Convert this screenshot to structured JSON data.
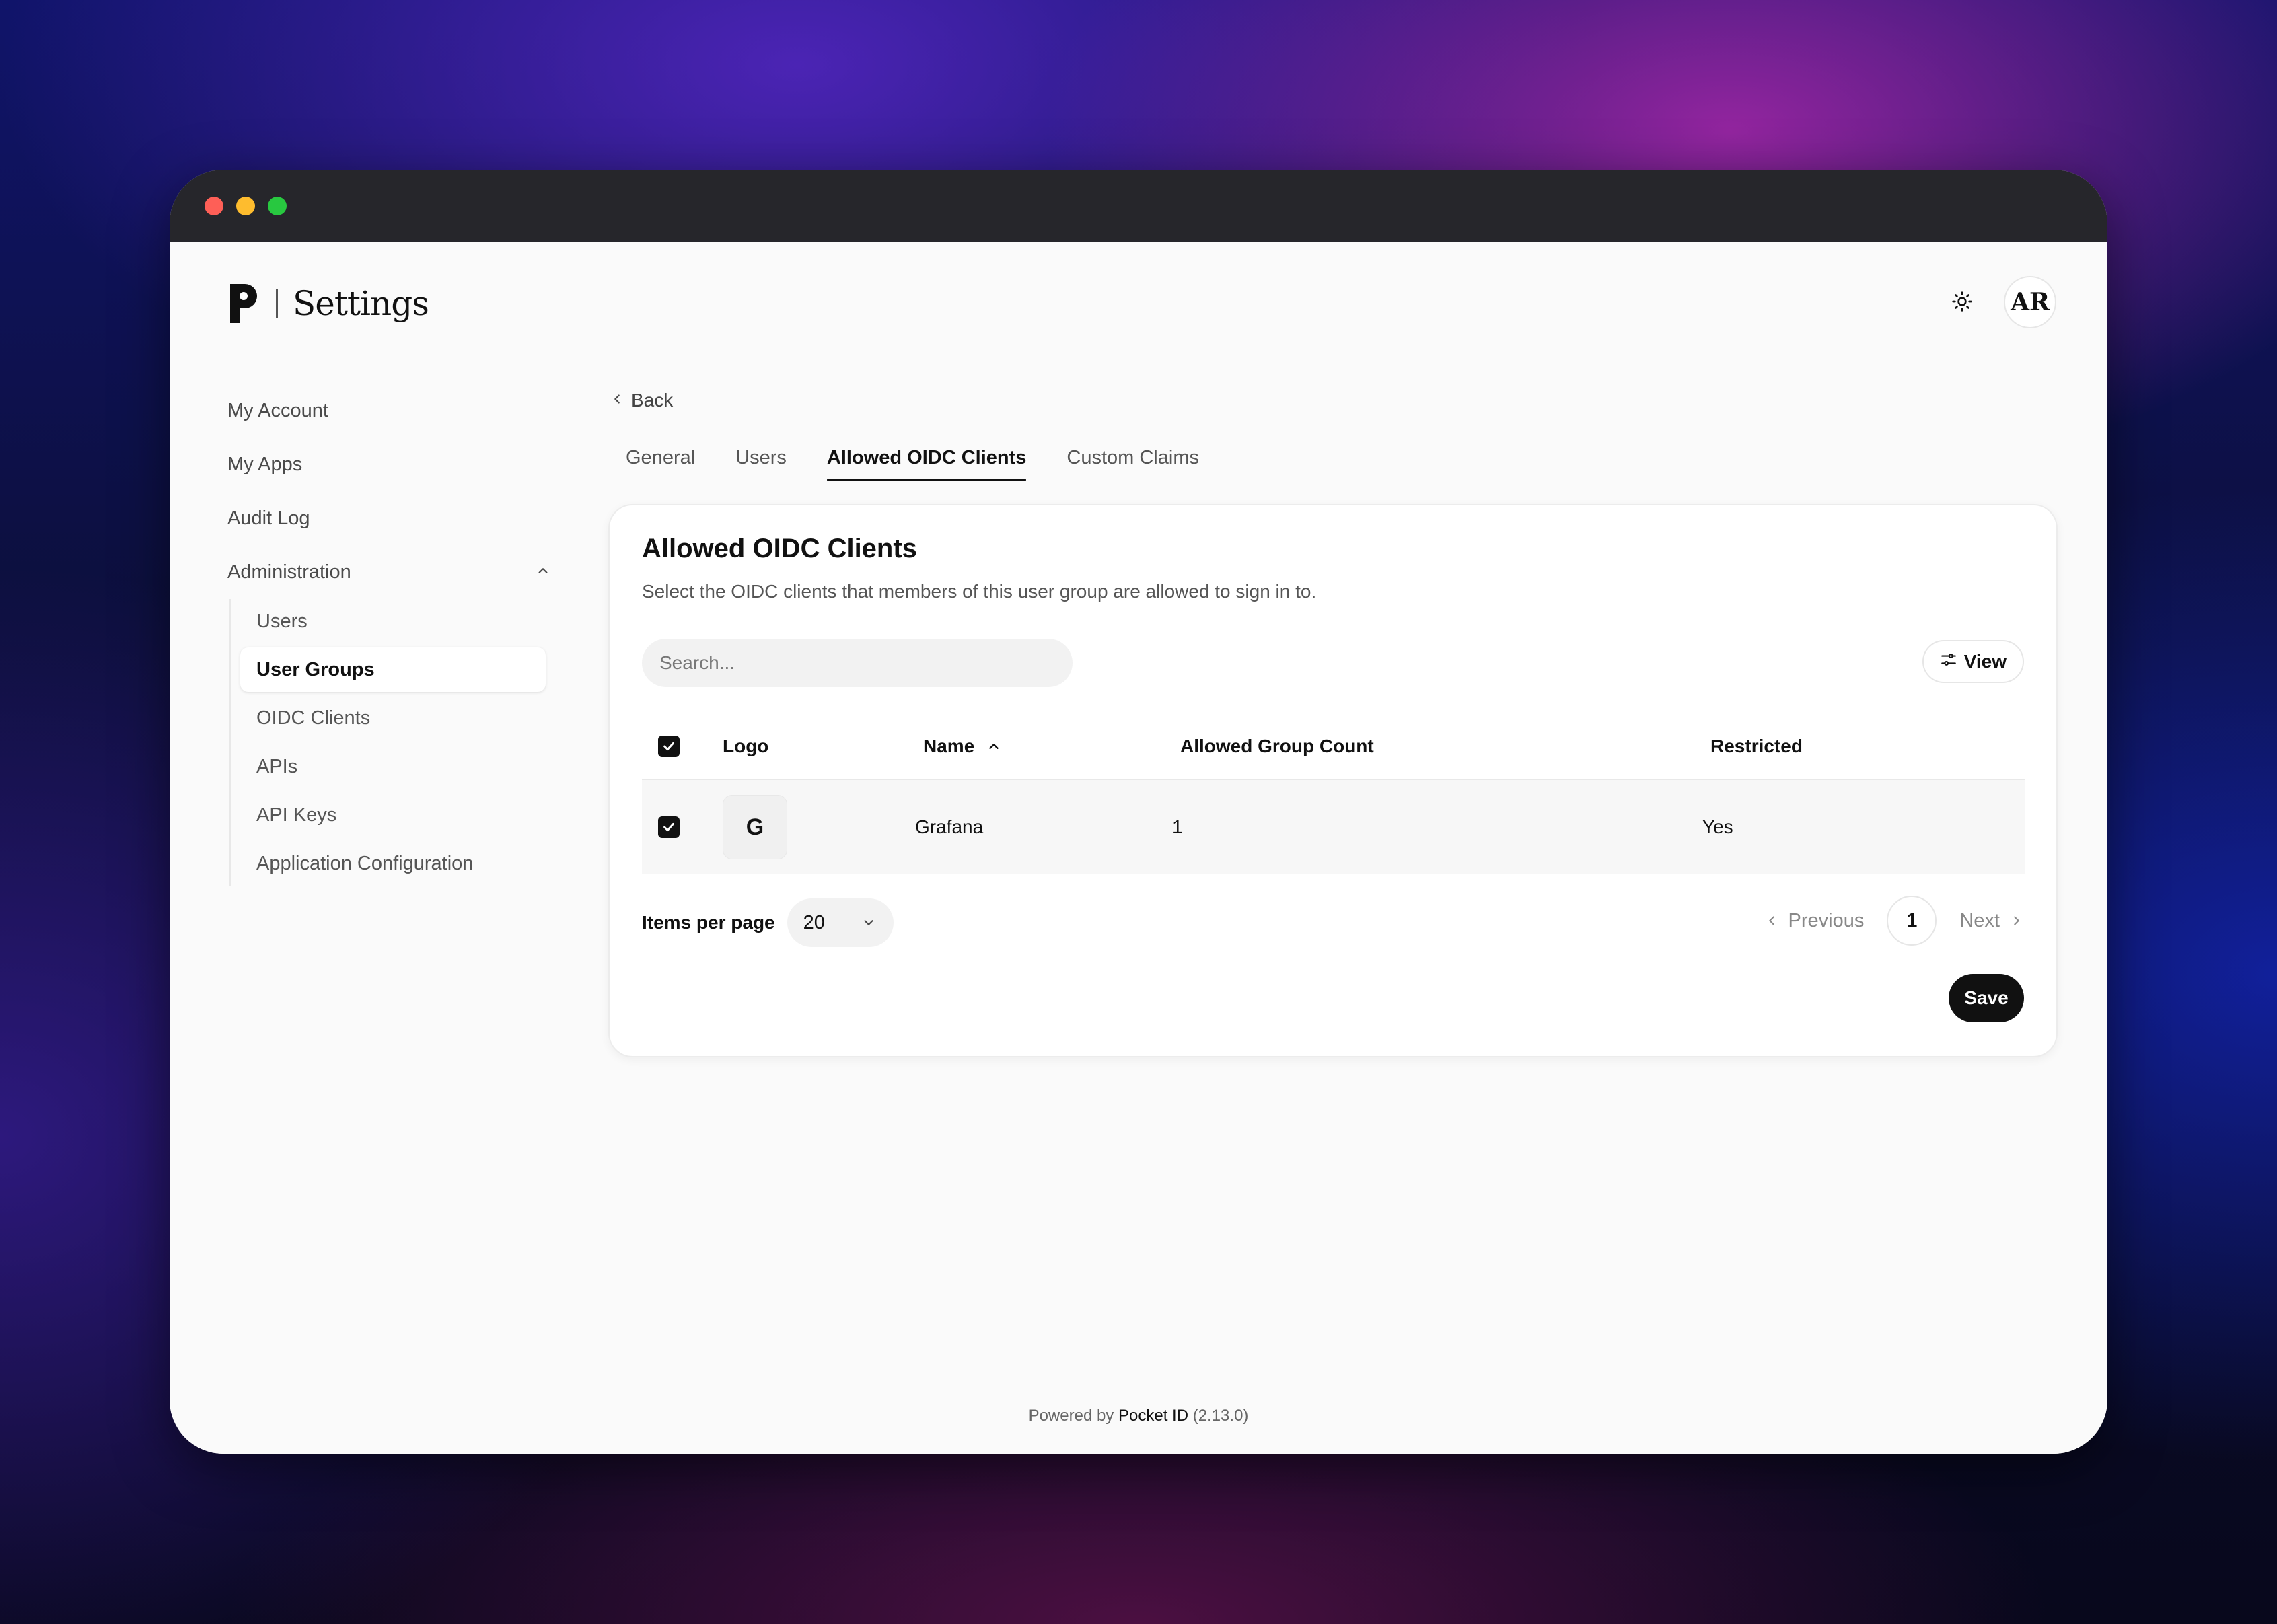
{
  "header": {
    "title": "Settings",
    "avatar_initials": "AR",
    "theme_icon": "sun-icon"
  },
  "sidebar": {
    "items": [
      {
        "label": "My Account"
      },
      {
        "label": "My Apps"
      },
      {
        "label": "Audit Log"
      }
    ],
    "admin_label": "Administration",
    "admin_items": [
      {
        "label": "Users"
      },
      {
        "label": "User Groups",
        "active": true
      },
      {
        "label": "OIDC Clients"
      },
      {
        "label": "APIs"
      },
      {
        "label": "API Keys"
      },
      {
        "label": "Application Configuration"
      }
    ]
  },
  "main": {
    "back_label": "Back",
    "tabs": [
      {
        "label": "General"
      },
      {
        "label": "Users"
      },
      {
        "label": "Allowed OIDC Clients",
        "active": true
      },
      {
        "label": "Custom Claims"
      }
    ],
    "card": {
      "title": "Allowed OIDC Clients",
      "description": "Select the OIDC clients that members of this user group are allowed to sign in to.",
      "search_placeholder": "Search...",
      "view_label": "View",
      "columns": {
        "logo": "Logo",
        "name": "Name",
        "allowed_group_count": "Allowed Group Count",
        "restricted": "Restricted"
      },
      "rows": [
        {
          "logo_letter": "G",
          "name": "Grafana",
          "allowed_group_count": "1",
          "restricted": "Yes",
          "checked": true
        }
      ],
      "items_per_page_label": "Items per page",
      "items_per_page_value": "20",
      "pagination": {
        "previous": "Previous",
        "current_page": "1",
        "next": "Next"
      },
      "save_label": "Save"
    }
  },
  "footer": {
    "prefix": "Powered by",
    "link": "Pocket ID",
    "version": "(2.13.0)"
  },
  "colors": {
    "accent": "#111111",
    "window_bg": "#fafafa",
    "titlebar": "#26262b"
  }
}
